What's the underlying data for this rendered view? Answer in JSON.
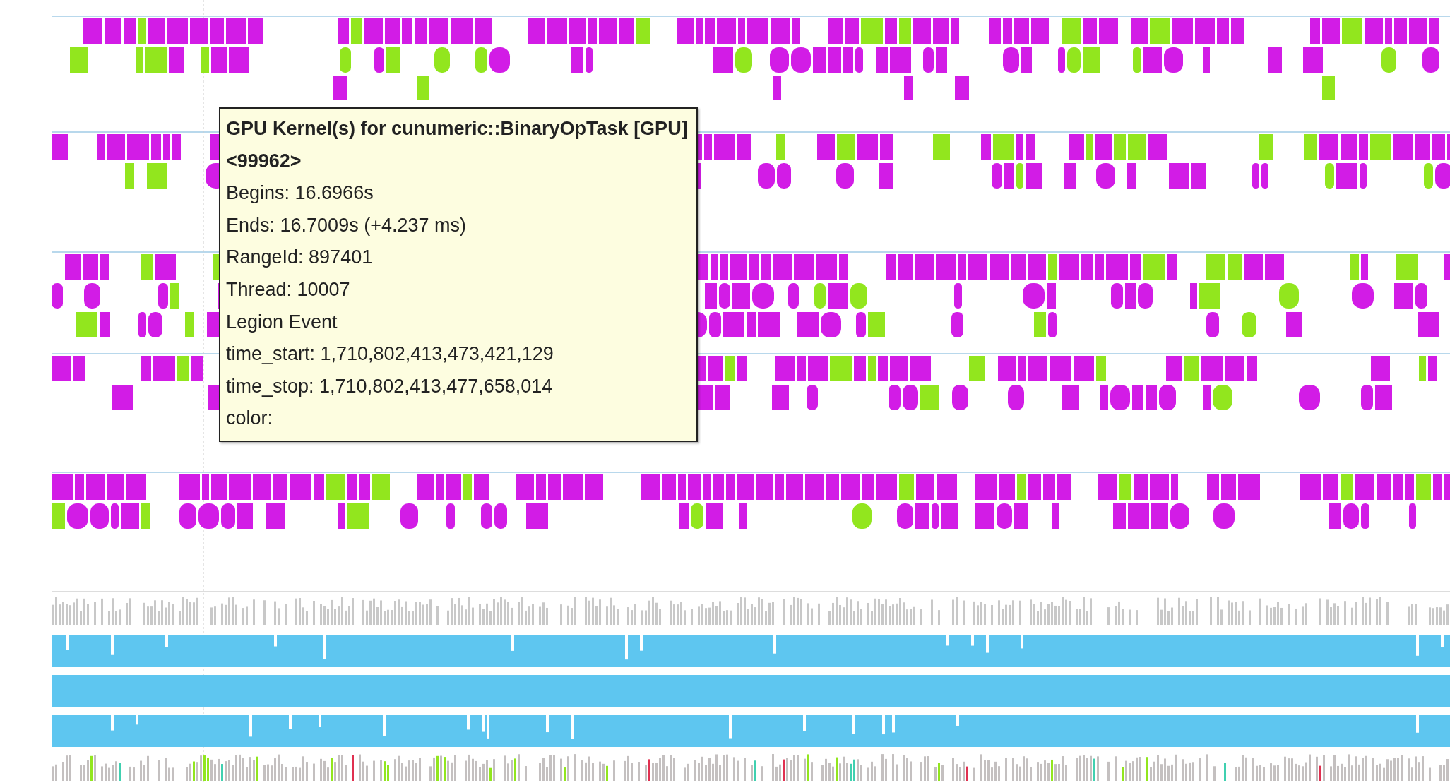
{
  "tooltip": {
    "title": "GPU Kernel(s) for cunumeric::BinaryOpTask [GPU]",
    "id": "<99962>",
    "lines": [
      "Begins: 16.6966s",
      "Ends: 16.7009s (+4.237 ms)",
      "RangeId: 897401",
      "Thread: 10007",
      "Legion Event",
      "time_start: 1,710,802,413,473,421,129",
      "time_stop: 1,710,802,413,477,658,014",
      "color:"
    ]
  }
}
